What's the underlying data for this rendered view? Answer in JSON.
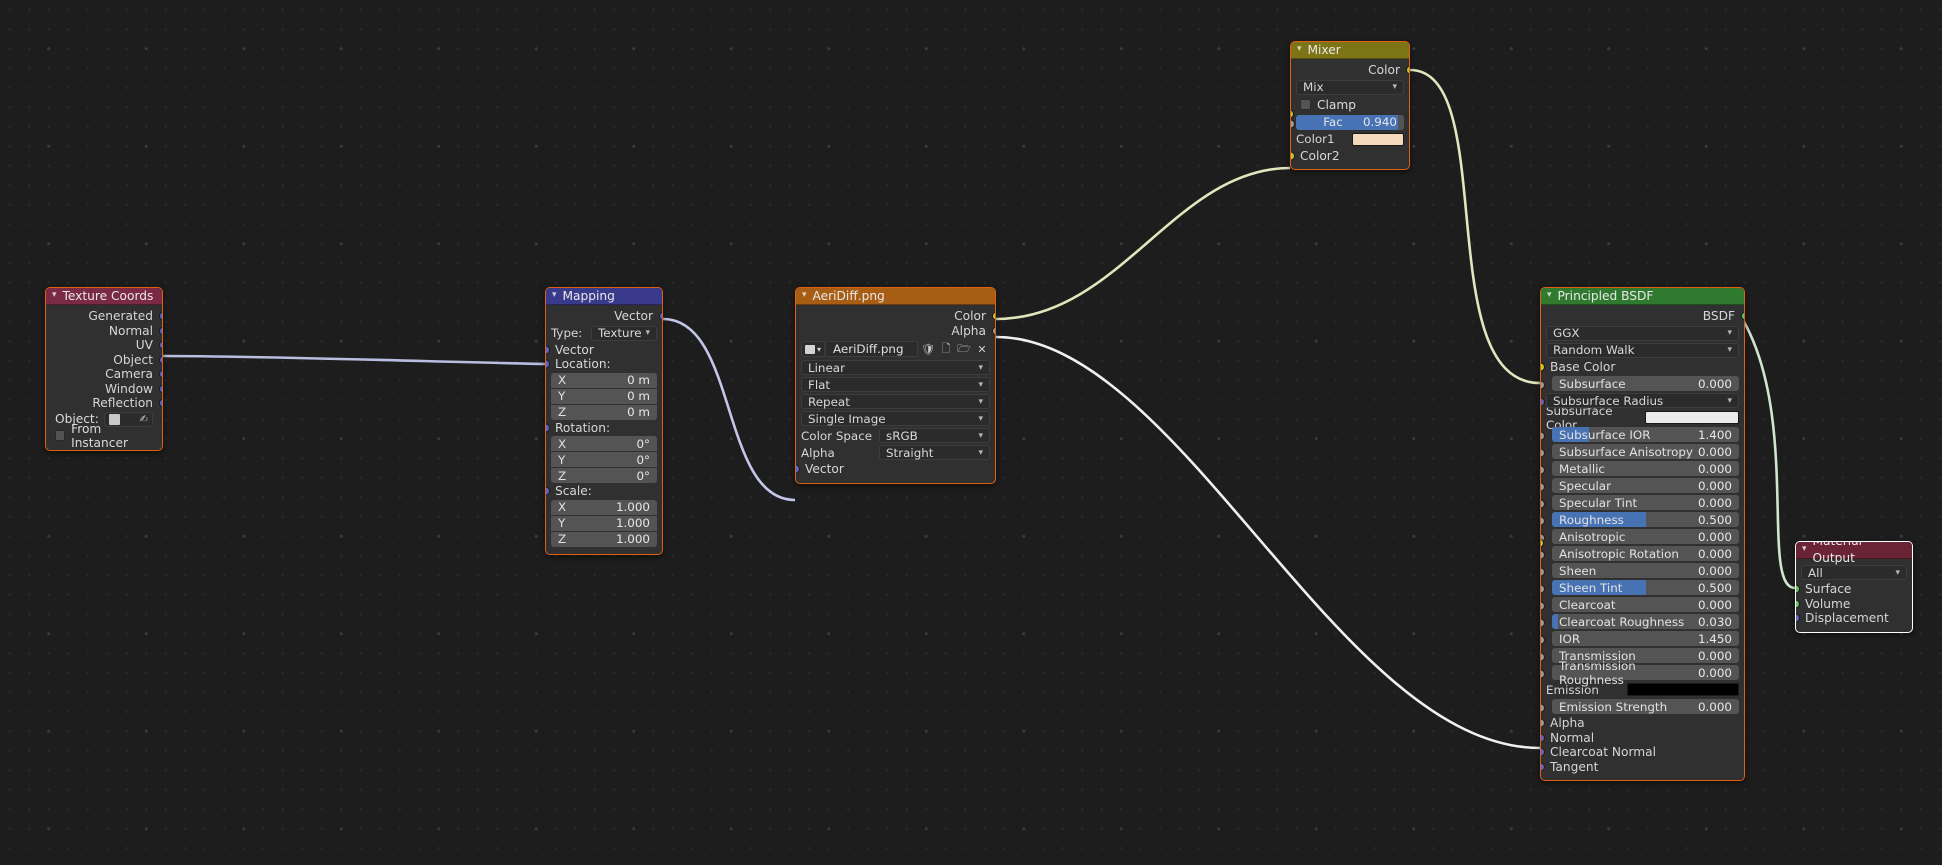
{
  "app": {
    "editor": "blender-shader-node-editor"
  },
  "nodes": {
    "texture_coords": {
      "title": "Texture Coords",
      "outputs": [
        "Generated",
        "Normal",
        "UV",
        "Object",
        "Camera",
        "Window",
        "Reflection"
      ],
      "object_label": "Object:",
      "object_value": "",
      "from_instancer_label": "From Instancer"
    },
    "mapping": {
      "title": "Mapping",
      "output": "Vector",
      "type_label": "Type:",
      "type_value": "Texture",
      "input_vector": "Vector",
      "location_label": "Location:",
      "location": [
        {
          "axis": "X",
          "value": "0 m"
        },
        {
          "axis": "Y",
          "value": "0 m"
        },
        {
          "axis": "Z",
          "value": "0 m"
        }
      ],
      "rotation_label": "Rotation:",
      "rotation": [
        {
          "axis": "X",
          "value": "0°"
        },
        {
          "axis": "Y",
          "value": "0°"
        },
        {
          "axis": "Z",
          "value": "0°"
        }
      ],
      "scale_label": "Scale:",
      "scale": [
        {
          "axis": "X",
          "value": "1.000"
        },
        {
          "axis": "Y",
          "value": "1.000"
        },
        {
          "axis": "Z",
          "value": "1.000"
        }
      ]
    },
    "image_texture": {
      "title": "AeriDiff.png",
      "outputs": [
        "Color",
        "Alpha"
      ],
      "filename": "AeriDiff.png",
      "interpolation": "Linear",
      "projection": "Flat",
      "extension": "Repeat",
      "source": "Single Image",
      "color_space_label": "Color Space",
      "color_space_value": "sRGB",
      "alpha_label": "Alpha",
      "alpha_value": "Straight",
      "input_vector": "Vector"
    },
    "mixer": {
      "title": "Mixer",
      "output": "Color",
      "blend_mode": "Mix",
      "clamp_label": "Clamp",
      "fac_label": "Fac",
      "fac_value": "0.940",
      "fac_fraction": 0.94,
      "color1_label": "Color1",
      "color1_hex": "#f5d9bb",
      "color2_label": "Color2"
    },
    "principled_bsdf": {
      "title": "Principled BSDF",
      "output": "BSDF",
      "distribution": "GGX",
      "subsurface_method": "Random Walk",
      "base_color_label": "Base Color",
      "subsurface_radius_label": "Subsurface Radius",
      "subsurface_color_label": "Subsurface Color",
      "subsurface_color_hex": "#ececec",
      "emission_label": "Emission",
      "emission_color_hex": "#000000",
      "sliders": [
        {
          "name": "Subsurface",
          "value": "0.000",
          "fill": 0.0,
          "indent": true
        },
        {
          "name": "Subsurface IOR",
          "value": "1.400",
          "fill": 0.2,
          "indent": true
        },
        {
          "name": "Subsurface Anisotropy",
          "value": "0.000",
          "fill": 0.0,
          "indent": true
        },
        {
          "name": "Metallic",
          "value": "0.000",
          "fill": 0.0,
          "indent": true
        },
        {
          "name": "Specular",
          "value": "0.000",
          "fill": 0.0,
          "indent": true
        },
        {
          "name": "Specular Tint",
          "value": "0.000",
          "fill": 0.0,
          "indent": true
        },
        {
          "name": "Roughness",
          "value": "0.500",
          "fill": 0.5,
          "indent": true
        },
        {
          "name": "Anisotropic",
          "value": "0.000",
          "fill": 0.0,
          "indent": true
        },
        {
          "name": "Anisotropic Rotation",
          "value": "0.000",
          "fill": 0.0,
          "indent": true
        },
        {
          "name": "Sheen",
          "value": "0.000",
          "fill": 0.0,
          "indent": true
        },
        {
          "name": "Sheen Tint",
          "value": "0.500",
          "fill": 0.5,
          "indent": true
        },
        {
          "name": "Clearcoat",
          "value": "0.000",
          "fill": 0.0,
          "indent": true
        },
        {
          "name": "Clearcoat Roughness",
          "value": "0.030",
          "fill": 0.03,
          "indent": true
        },
        {
          "name": "IOR",
          "value": "1.450",
          "fill": 0.0,
          "indent": true
        },
        {
          "name": "Transmission",
          "value": "0.000",
          "fill": 0.0,
          "indent": true
        },
        {
          "name": "Transmission Roughness",
          "value": "0.000",
          "fill": 0.0,
          "indent": true
        }
      ],
      "emission_strength": {
        "name": "Emission Strength",
        "value": "0.000"
      },
      "tail_inputs": [
        "Alpha",
        "Normal",
        "Clearcoat Normal",
        "Tangent"
      ]
    },
    "material_output": {
      "title": "Material Output",
      "target": "All",
      "inputs": [
        "Surface",
        "Volume",
        "Displacement"
      ]
    }
  },
  "links": [
    {
      "from": "texture_coords.UV",
      "to": "mapping.Vector",
      "color": "#b9bde0"
    },
    {
      "from": "mapping.Vector",
      "to": "image_texture.Vector",
      "color": "#c3c6e8"
    },
    {
      "from": "image_texture.Color",
      "to": "mixer.Color2",
      "color": "#e3e5bc"
    },
    {
      "from": "mixer.Color",
      "to": "principled_bsdf.BaseColor",
      "color": "#e3e5bc"
    },
    {
      "from": "image_texture.Alpha",
      "to": "principled_bsdf.Alpha",
      "color": "#f0f0f0"
    },
    {
      "from": "principled_bsdf.BSDF",
      "to": "material_output.Surface",
      "color": "#cfe6cf"
    }
  ],
  "colors": {
    "node_border": "#e06014",
    "node_border_active": "#ffffff",
    "socket_vector": "#6363c7",
    "socket_color": "#c7c729",
    "socket_value": "#9a9a9a",
    "socket_shader": "#64c764",
    "slider_fill": "#4772b3",
    "background": "#1d1d1d"
  }
}
